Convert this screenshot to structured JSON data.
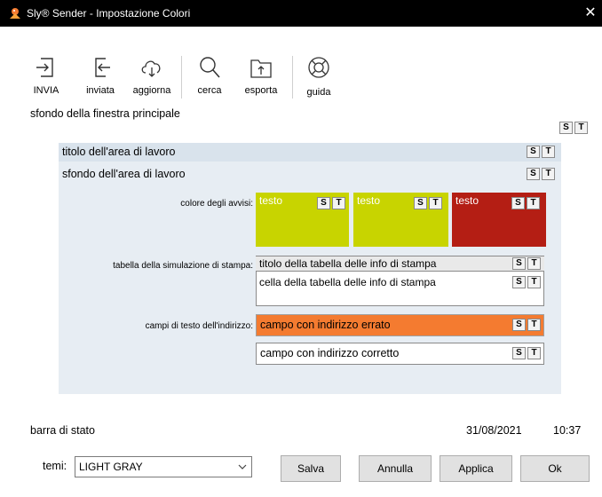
{
  "window": {
    "title": "Sly® Sender - Impostazione Colori",
    "close": "✕"
  },
  "toolbar": [
    {
      "label": "INVIA",
      "icon": "send-icon"
    },
    {
      "label": "inviata",
      "icon": "sent-icon"
    },
    {
      "label": "aggiorna",
      "icon": "cloud-refresh-icon"
    },
    {
      "label": "cerca",
      "icon": "search-icon"
    },
    {
      "label": "esporta",
      "icon": "export-icon"
    },
    {
      "label": "guida",
      "icon": "help-lifebuoy-icon"
    }
  ],
  "main_background_label": "sfondo della finestra principale",
  "s_label": "S",
  "t_label": "T",
  "work_area": {
    "title_label": "titolo dell'area di lavoro",
    "background_label": "sfondo dell'area di lavoro",
    "warnings": {
      "label": "colore degli avvisi:",
      "swatches": [
        {
          "text": "testo",
          "color": "#c8d400"
        },
        {
          "text": "testo",
          "color": "#c8d400"
        },
        {
          "text": "testo",
          "color": "#b41e14"
        }
      ]
    },
    "print_table": {
      "label": "tabella della simulazione di stampa:",
      "header": "titolo della tabella delle info di stampa",
      "cell": "cella della tabella delle info di stampa"
    },
    "address_fields": {
      "label": "campi di testo dell'indirizzo:",
      "wrong": "campo con indirizzo errato",
      "correct": "campo con indirizzo corretto"
    }
  },
  "status_bar": {
    "label": "barra di stato",
    "date": "31/08/2021",
    "time": "10:37"
  },
  "footer": {
    "theme_label": "temi:",
    "theme_value": "LIGHT GRAY",
    "save": "Salva",
    "cancel": "Annulla",
    "apply": "Applica",
    "ok": "Ok"
  },
  "colors": {
    "accent_orange": "#f47b30",
    "warning_yellow": "#c8d400",
    "warning_red": "#b41e14",
    "work_area_bg": "#e7edf3",
    "title_bar_bg": "#d9e3ec"
  }
}
